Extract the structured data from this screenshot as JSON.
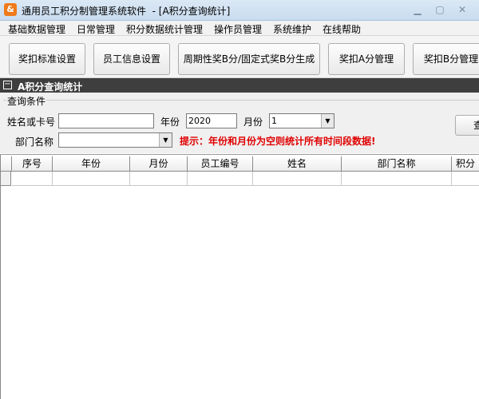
{
  "window": {
    "app_icon": "&",
    "title": "通用员工积分制管理系统软件  - [A积分查询统计]",
    "minimize_icon": "minimize-icon",
    "maximize_icon": "maximize-icon",
    "close_icon": "close-icon"
  },
  "menu": [
    "基础数据管理",
    "日常管理",
    "积分数据统计管理",
    "操作员管理",
    "系统维护",
    "在线帮助"
  ],
  "toolbar": [
    "奖扣标准设置",
    "员工信息设置",
    "周期性奖B分/固定式奖B分生成",
    "奖扣A分管理",
    "奖扣B分管理"
  ],
  "group": {
    "collapse_symbol": "−",
    "title": "A积分查询统计"
  },
  "query": {
    "legend": "查询条件",
    "name_label": "姓名或卡号",
    "name_value": "",
    "year_label": "年份",
    "year_value": "2020",
    "month_label": "月份",
    "month_value": "1",
    "dept_label": "部门名称",
    "dept_value": "",
    "hint": "提示：年份和月份为空则统计所有时间段数据!",
    "query_button": "查"
  },
  "grid": {
    "columns": [
      "序号",
      "年份",
      "月份",
      "员工编号",
      "姓名",
      "部门名称",
      "积分"
    ],
    "row_indicator": "▶"
  }
}
